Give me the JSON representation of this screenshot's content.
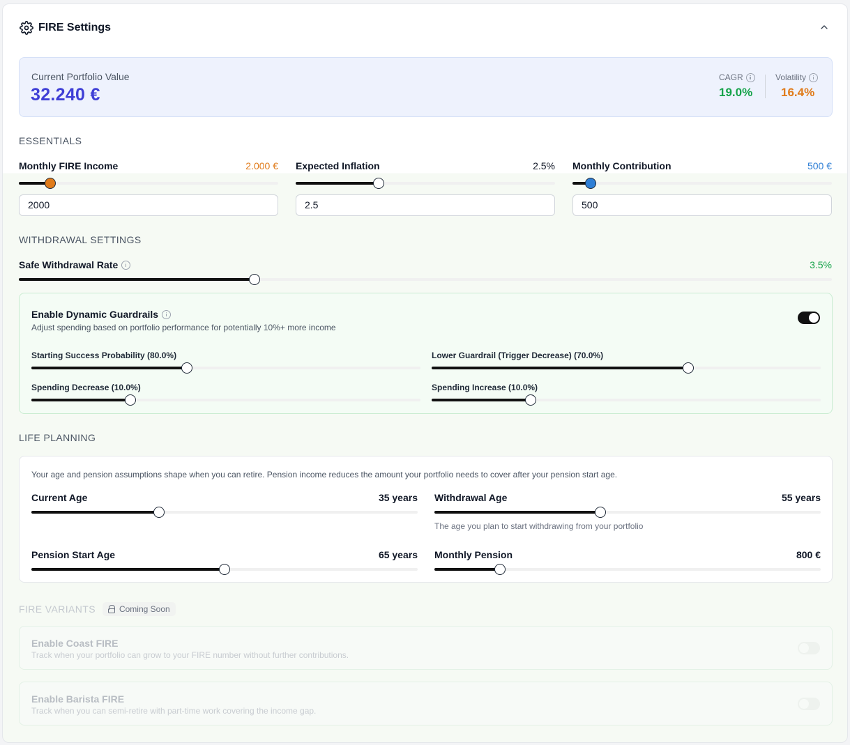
{
  "header": {
    "title": "FIRE Settings",
    "gear_icon": "gear-icon",
    "collapse_icon": "chevron-up-icon"
  },
  "portfolio": {
    "label": "Current Portfolio Value",
    "value": "32.240 €",
    "cagr_label": "CAGR",
    "cagr_value": "19.0%",
    "volatility_label": "Volatility",
    "volatility_value": "16.4%",
    "colors": {
      "value": "#3f3fd6",
      "cagr": "#16a34a",
      "volatility": "#e07b1a"
    }
  },
  "essentials": {
    "title": "ESSENTIALS",
    "monthly_income": {
      "label": "Monthly FIRE Income",
      "display": "2.000 €",
      "input": "2000",
      "fraction": 0.12,
      "color": "#e07b1a"
    },
    "inflation": {
      "label": "Expected Inflation",
      "display": "2.5%",
      "input": "2.5",
      "fraction": 0.32
    },
    "contribution": {
      "label": "Monthly Contribution",
      "display": "500 €",
      "input": "500",
      "fraction": 0.07,
      "color": "#2f7fd6"
    }
  },
  "withdrawal": {
    "title": "WITHDRAWAL SETTINGS",
    "swr": {
      "label": "Safe Withdrawal Rate",
      "display": "3.5%",
      "fraction": 0.29
    },
    "guardrails": {
      "title": "Enable Dynamic Guardrails",
      "description": "Adjust spending based on portfolio performance for potentially 10%+ more income",
      "enabled": true,
      "starting_success": {
        "label": "Starting Success Probability (80.0%)",
        "fraction": 0.4
      },
      "lower_guardrail": {
        "label": "Lower Guardrail (Trigger Decrease) (70.0%)",
        "fraction": 0.66
      },
      "spending_decrease": {
        "label": "Spending Decrease (10.0%)",
        "fraction": 0.255
      },
      "spending_increase": {
        "label": "Spending Increase (10.0%)",
        "fraction": 0.255
      }
    }
  },
  "life": {
    "title": "LIFE PLANNING",
    "description": "Your age and pension assumptions shape when you can retire. Pension income reduces the amount your portfolio needs to cover after your pension start age.",
    "current_age": {
      "label": "Current Age",
      "display": "35 years",
      "fraction": 0.33
    },
    "withdrawal_age": {
      "label": "Withdrawal Age",
      "display": "55 years",
      "fraction": 0.43,
      "hint": "The age you plan to start withdrawing from your portfolio"
    },
    "pension_age": {
      "label": "Pension Start Age",
      "display": "65 years",
      "fraction": 0.5
    },
    "monthly_pension": {
      "label": "Monthly Pension",
      "display": "800 €",
      "fraction": 0.17
    }
  },
  "variants": {
    "title": "FIRE VARIANTS",
    "badge": "Coming Soon",
    "coast": {
      "title": "Enable Coast FIRE",
      "description": "Track when your portfolio can grow to your FIRE number without further contributions."
    },
    "barista": {
      "title": "Enable Barista FIRE",
      "description": "Track when you can semi-retire with part-time work covering the income gap."
    }
  }
}
